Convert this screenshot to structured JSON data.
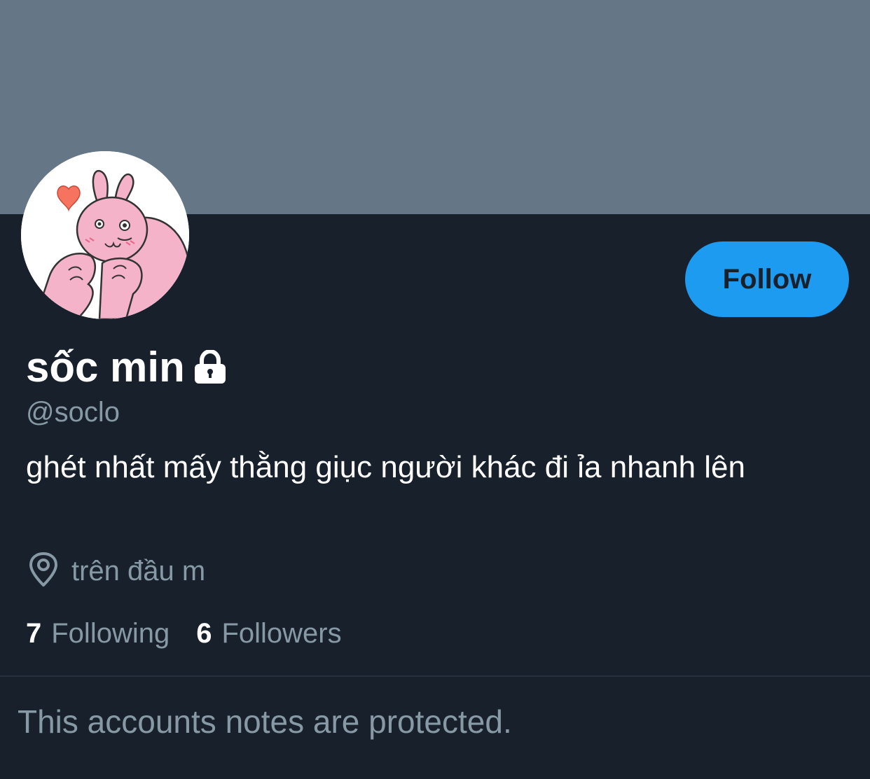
{
  "profile": {
    "display_name": "sốc min",
    "handle": "@soclo",
    "bio": "ghét nhất mấy thằng giục người khác đi ỉa nhanh lên",
    "location": "trên đầu m",
    "protected": true
  },
  "actions": {
    "follow_label": "Follow"
  },
  "stats": {
    "following_count": "7",
    "following_label": "Following",
    "followers_count": "6",
    "followers_label": "Followers"
  },
  "notice": {
    "text": "This accounts notes are protected."
  },
  "icons": {
    "lock": "lock-icon",
    "location": "location-pin-icon"
  },
  "colors": {
    "background": "#17202b",
    "banner": "#657786",
    "accent": "#1d9bf0",
    "secondary_text": "#8899a6",
    "primary_text": "#ffffff"
  }
}
